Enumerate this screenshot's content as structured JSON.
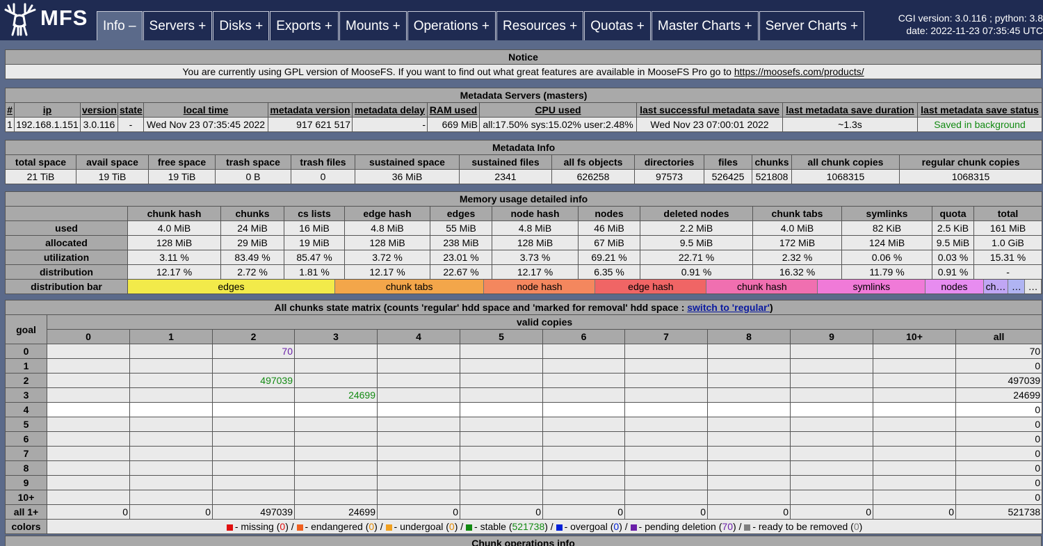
{
  "header": {
    "logo_text": "MFS",
    "tabs": [
      {
        "label": "Info –",
        "active": true
      },
      {
        "label": "Servers +",
        "active": false
      },
      {
        "label": "Disks +",
        "active": false
      },
      {
        "label": "Exports +",
        "active": false
      },
      {
        "label": "Mounts +",
        "active": false
      },
      {
        "label": "Operations +",
        "active": false
      },
      {
        "label": "Resources +",
        "active": false
      },
      {
        "label": "Quotas +",
        "active": false
      },
      {
        "label": "Master Charts +",
        "active": false
      },
      {
        "label": "Server Charts +",
        "active": false
      }
    ],
    "cgi_line": "CGI version: 3.0.116 ; python: 3.8",
    "date_line": "date: 2022-11-23 07:35:45 UTC"
  },
  "notice": {
    "title": "Notice",
    "text": "You are currently using GPL version of MooseFS. If you want to find out what great features are available in MooseFS Pro go to ",
    "link": "https://moosefs.com/products/"
  },
  "masters": {
    "title": "Metadata Servers (masters)",
    "headers": [
      "#",
      "ip",
      "version",
      "state",
      "local time",
      "metadata version",
      "metadata delay",
      "RAM used",
      "CPU used",
      "last successful metadata save",
      "last metadata save duration",
      "last metadata save status"
    ],
    "row": [
      "1",
      "192.168.1.151",
      "3.0.116",
      "-",
      "Wed Nov 23 07:35:45 2022",
      "917 621 517",
      "-",
      "669 MiB",
      "all:17.50% sys:15.02% user:2.48%",
      "Wed Nov 23 07:00:01 2022",
      "~1.3s",
      "Saved in background"
    ]
  },
  "meta_info": {
    "title": "Metadata Info",
    "headers": [
      "total space",
      "avail space",
      "free space",
      "trash space",
      "trash files",
      "sustained space",
      "sustained files",
      "all fs objects",
      "directories",
      "files",
      "chunks",
      "all chunk copies",
      "regular chunk copies"
    ],
    "row": [
      "21 TiB",
      "19 TiB",
      "19 TiB",
      "0 B",
      "0",
      "36 MiB",
      "2341",
      "626258",
      "97573",
      "526425",
      "521808",
      "1068315",
      "1068315"
    ]
  },
  "memory": {
    "title": "Memory usage detailed info",
    "headers": [
      "",
      "chunk hash",
      "chunks",
      "cs lists",
      "edge hash",
      "edges",
      "node hash",
      "nodes",
      "deleted nodes",
      "chunk tabs",
      "symlinks",
      "quota",
      "total"
    ],
    "rows": [
      {
        "label": "used",
        "values": [
          "4.0 MiB",
          "24 MiB",
          "16 MiB",
          "4.8 MiB",
          "55 MiB",
          "4.8 MiB",
          "46 MiB",
          "2.2 MiB",
          "4.0 MiB",
          "82 KiB",
          "2.5 KiB",
          "161 MiB"
        ]
      },
      {
        "label": "allocated",
        "values": [
          "128 MiB",
          "29 MiB",
          "19 MiB",
          "128 MiB",
          "238 MiB",
          "128 MiB",
          "67 MiB",
          "9.5 MiB",
          "172 MiB",
          "124 MiB",
          "9.5 MiB",
          "1.0 GiB"
        ]
      },
      {
        "label": "utilization",
        "values": [
          "3.11 %",
          "83.49 %",
          "85.47 %",
          "3.72 %",
          "23.01 %",
          "3.73 %",
          "69.21 %",
          "22.71 %",
          "2.32 %",
          "0.06 %",
          "0.03 %",
          "15.31 %"
        ]
      },
      {
        "label": "distribution",
        "values": [
          "12.17 %",
          "2.72 %",
          "1.81 %",
          "12.17 %",
          "22.67 %",
          "12.17 %",
          "6.35 %",
          "0.91 %",
          "16.32 %",
          "11.79 %",
          "0.91 %",
          "-"
        ]
      }
    ],
    "bar_label": "distribution bar",
    "bar": [
      {
        "label": "edges",
        "pct": 22.67,
        "color": "#f2ea4a"
      },
      {
        "label": "chunk tabs",
        "pct": 16.32,
        "color": "#f3a64a"
      },
      {
        "label": "node hash",
        "pct": 12.17,
        "color": "#f4875e"
      },
      {
        "label": "edge hash",
        "pct": 12.17,
        "color": "#f06565"
      },
      {
        "label": "chunk hash",
        "pct": 12.17,
        "color": "#f06fb0"
      },
      {
        "label": "symlinks",
        "pct": 11.79,
        "color": "#f07ad8"
      },
      {
        "label": "nodes",
        "pct": 6.35,
        "color": "#e78cf0"
      },
      {
        "label": "ch…",
        "pct": 2.72,
        "color": "#c0a6f4"
      },
      {
        "label": "…",
        "pct": 1.81,
        "color": "#b0b4f2"
      },
      {
        "label": "…",
        "pct": 1.81,
        "color": "#e6e6e6"
      }
    ]
  },
  "matrix": {
    "title_prefix": "All chunks state matrix (counts 'regular' hdd space and 'marked for removal' hdd space : ",
    "title_link": "switch to 'regular'",
    "title_suffix": ")",
    "goal_label": "goal",
    "valid_label": "valid copies",
    "col_headers": [
      "0",
      "1",
      "2",
      "3",
      "4",
      "5",
      "6",
      "7",
      "8",
      "9",
      "10+",
      "all"
    ],
    "rows": [
      {
        "goal": "0",
        "cells": [
          "",
          "",
          "70",
          "",
          "",
          "",
          "",
          "",
          "",
          "",
          "",
          "70"
        ],
        "cls": [
          "",
          "",
          "purple",
          "",
          "",
          "",
          "",
          "",
          "",
          "",
          "",
          ""
        ]
      },
      {
        "goal": "1",
        "cells": [
          "",
          "",
          "",
          "",
          "",
          "",
          "",
          "",
          "",
          "",
          "",
          "0"
        ],
        "cls": [
          "",
          "",
          "",
          "",
          "",
          "",
          "",
          "",
          "",
          "",
          "",
          ""
        ]
      },
      {
        "goal": "2",
        "cells": [
          "",
          "",
          "497039",
          "",
          "",
          "",
          "",
          "",
          "",
          "",
          "",
          "497039"
        ],
        "cls": [
          "",
          "",
          "green",
          "",
          "",
          "",
          "",
          "",
          "",
          "",
          "",
          ""
        ]
      },
      {
        "goal": "3",
        "cells": [
          "",
          "",
          "",
          "24699",
          "",
          "",
          "",
          "",
          "",
          "",
          "",
          "24699"
        ],
        "cls": [
          "",
          "",
          "",
          "green",
          "",
          "",
          "",
          "",
          "",
          "",
          "",
          ""
        ]
      },
      {
        "goal": "4",
        "cells": [
          "",
          "",
          "",
          "",
          "",
          "",
          "",
          "",
          "",
          "",
          "",
          "0"
        ],
        "cls": [
          "",
          "",
          "",
          "",
          "",
          "",
          "",
          "",
          "",
          "",
          "",
          ""
        ],
        "white": true
      },
      {
        "goal": "5",
        "cells": [
          "",
          "",
          "",
          "",
          "",
          "",
          "",
          "",
          "",
          "",
          "",
          "0"
        ],
        "cls": [
          "",
          "",
          "",
          "",
          "",
          "",
          "",
          "",
          "",
          "",
          "",
          ""
        ]
      },
      {
        "goal": "6",
        "cells": [
          "",
          "",
          "",
          "",
          "",
          "",
          "",
          "",
          "",
          "",
          "",
          "0"
        ],
        "cls": [
          "",
          "",
          "",
          "",
          "",
          "",
          "",
          "",
          "",
          "",
          "",
          ""
        ]
      },
      {
        "goal": "7",
        "cells": [
          "",
          "",
          "",
          "",
          "",
          "",
          "",
          "",
          "",
          "",
          "",
          "0"
        ],
        "cls": [
          "",
          "",
          "",
          "",
          "",
          "",
          "",
          "",
          "",
          "",
          "",
          ""
        ]
      },
      {
        "goal": "8",
        "cells": [
          "",
          "",
          "",
          "",
          "",
          "",
          "",
          "",
          "",
          "",
          "",
          "0"
        ],
        "cls": [
          "",
          "",
          "",
          "",
          "",
          "",
          "",
          "",
          "",
          "",
          "",
          ""
        ]
      },
      {
        "goal": "9",
        "cells": [
          "",
          "",
          "",
          "",
          "",
          "",
          "",
          "",
          "",
          "",
          "",
          "0"
        ],
        "cls": [
          "",
          "",
          "",
          "",
          "",
          "",
          "",
          "",
          "",
          "",
          "",
          ""
        ]
      },
      {
        "goal": "10+",
        "cells": [
          "",
          "",
          "",
          "",
          "",
          "",
          "",
          "",
          "",
          "",
          "",
          "0"
        ],
        "cls": [
          "",
          "",
          "",
          "",
          "",
          "",
          "",
          "",
          "",
          "",
          "",
          ""
        ]
      },
      {
        "goal": "all 1+",
        "cells": [
          "0",
          "0",
          "497039",
          "24699",
          "0",
          "0",
          "0",
          "0",
          "0",
          "0",
          "0",
          "521738"
        ],
        "cls": [
          "",
          "",
          "",
          "",
          "",
          "",
          "",
          "",
          "",
          "",
          "",
          ""
        ]
      }
    ],
    "colors_label": "colors",
    "legend": [
      {
        "color": "#e01010",
        "text": "- missing (",
        "count": "0",
        "cls": "red",
        "sep": ") / "
      },
      {
        "color": "#f06020",
        "text": "- endangered (",
        "count": "0",
        "cls": "orange",
        "sep": ") / "
      },
      {
        "color": "#f0a020",
        "text": "- undergoal (",
        "count": "0",
        "cls": "orange",
        "sep": ") / "
      },
      {
        "color": "#128a12",
        "text": "- stable (",
        "count": "521738",
        "cls": "green",
        "sep": ") / "
      },
      {
        "color": "#0020d8",
        "text": "- overgoal (",
        "count": "0",
        "cls": "blue",
        "sep": ") / "
      },
      {
        "color": "#6a1fa8",
        "text": "- pending deletion (",
        "count": "70",
        "cls": "purple",
        "sep": ") / "
      },
      {
        "color": "#808080",
        "text": "- ready to be removed (",
        "count": "0",
        "cls": "gray",
        "sep": ")"
      }
    ]
  },
  "chunk_ops": {
    "title": "Chunk operations info"
  }
}
